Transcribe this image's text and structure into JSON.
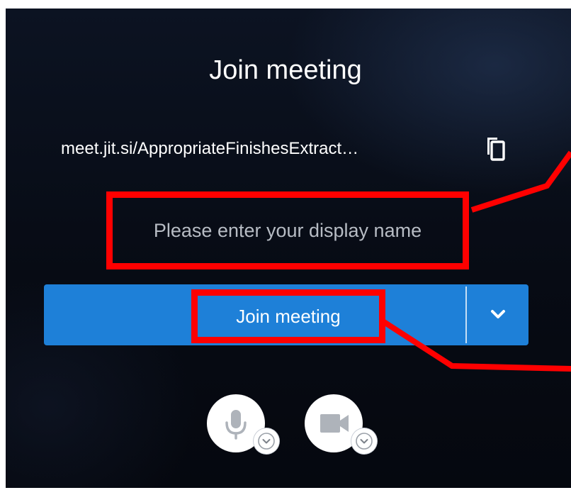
{
  "prejoin": {
    "title": "Join meeting",
    "meeting_url": "meet.jit.si/AppropriateFinishesExtract…",
    "display_name_placeholder": "Please enter your display name",
    "display_name_value": "",
    "join_button_label": "Join meeting"
  },
  "icons": {
    "copy": "copy-icon",
    "dropdown": "chevron-down-icon",
    "microphone": "microphone-icon",
    "camera": "camera-icon",
    "device_arrow": "chevron-down-icon"
  },
  "colors": {
    "background": "#080d18",
    "primary_button": "#1e80d8",
    "highlight": "#ff0000",
    "text": "#ffffff"
  }
}
